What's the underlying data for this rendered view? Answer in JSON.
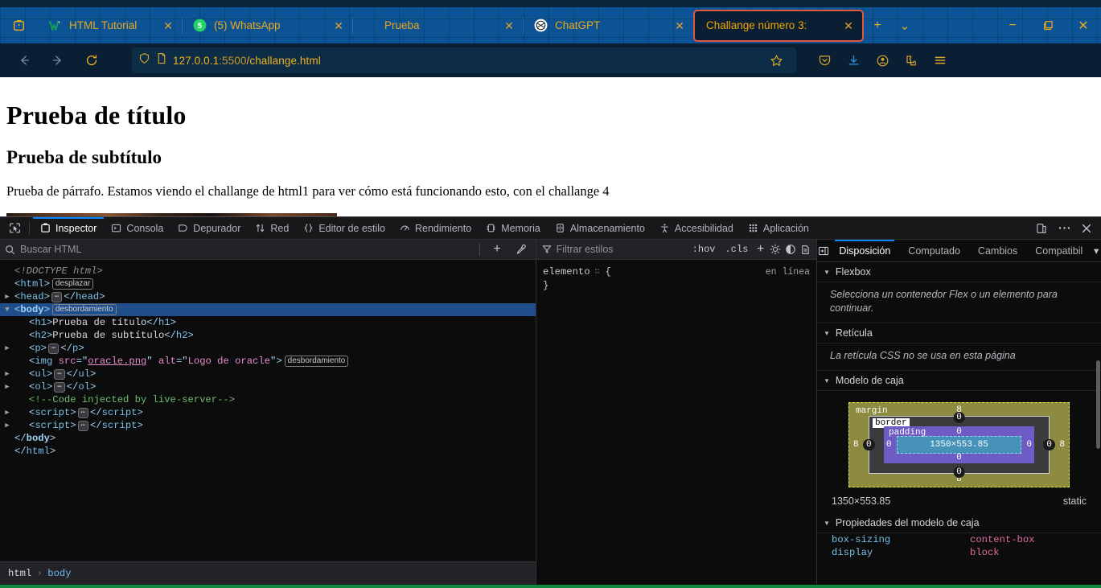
{
  "browser": {
    "tabs": [
      {
        "title": "HTML Tutorial",
        "favicon": "w3schools-icon",
        "active": false,
        "close_label": "✕"
      },
      {
        "title": "(5) WhatsApp",
        "favicon": "whatsapp-icon",
        "active": false,
        "close_label": "✕",
        "badge": "5"
      },
      {
        "title": "Prueba",
        "favicon": "blank-icon",
        "active": false,
        "close_label": "✕"
      },
      {
        "title": "ChatGPT",
        "favicon": "chatgpt-icon",
        "active": false,
        "close_label": "✕"
      },
      {
        "title": "Challange número 3:",
        "favicon": "none",
        "active": true,
        "close_label": "✕"
      }
    ],
    "new_tab_label": "+",
    "tab_list_label": "⌄",
    "window_controls": {
      "minimize": "−",
      "maximize": "❐",
      "close": "✕"
    },
    "nav": {
      "back": "←",
      "forward": "→",
      "reload": "⟳"
    },
    "url": {
      "value": "127.0.0.1:5500/challange.html",
      "host": "127.0.0.1",
      "port": ":5500",
      "path": "/challange.html"
    },
    "toolbar_icons": [
      "shield-icon",
      "page-icon",
      "bookmark-star-icon",
      "pocket-icon",
      "downloads-icon",
      "account-icon",
      "extensions-icon",
      "app-menu-icon"
    ],
    "active_tab_border_color": "#e2563c",
    "tabstrip_color": "#0b5394",
    "accent_color": "#f0a500"
  },
  "page": {
    "h1": "Prueba de título",
    "h2": "Prueba de subtítulo",
    "paragraph": "Prueba de párrafo. Estamos viendo el challange de html1 para ver cómo está funcionando esto, con el challange 4",
    "image_alt": "Logo de oracle"
  },
  "devtools": {
    "tabs": [
      {
        "label": "Inspector",
        "icon": "inspector-icon",
        "active": true
      },
      {
        "label": "Consola",
        "icon": "console-icon",
        "active": false
      },
      {
        "label": "Depurador",
        "icon": "debugger-icon",
        "active": false
      },
      {
        "label": "Red",
        "icon": "network-icon",
        "active": false
      },
      {
        "label": "Editor de estilo",
        "icon": "style-editor-icon",
        "active": false
      },
      {
        "label": "Rendimiento",
        "icon": "performance-icon",
        "active": false
      },
      {
        "label": "Memoria",
        "icon": "memory-icon",
        "active": false
      },
      {
        "label": "Almacenamiento",
        "icon": "storage-icon",
        "active": false
      },
      {
        "label": "Accesibilidad",
        "icon": "accessibility-icon",
        "active": false
      },
      {
        "label": "Aplicación",
        "icon": "application-icon",
        "active": false
      }
    ],
    "left_tools": [
      "node-picker-icon",
      "responsive-design-icon"
    ],
    "right_tools": [
      "split-console-icon",
      "meatball-menu-icon",
      "close-devtools-icon"
    ],
    "markup": {
      "search_placeholder": "Buscar HTML",
      "add_node_label": "+",
      "eyedropper_label": "eyedropper-icon",
      "tree": [
        {
          "indent": 0,
          "kind": "doctype",
          "text": "<!DOCTYPE html>"
        },
        {
          "indent": 0,
          "kind": "open",
          "tag": "html",
          "badge": "desplazar"
        },
        {
          "indent": 1,
          "kind": "collapsed",
          "tag": "head"
        },
        {
          "indent": 1,
          "kind": "open",
          "tag": "body",
          "badge": "desbordamiento",
          "selected": true
        },
        {
          "indent": 2,
          "kind": "text-node",
          "tag": "h1",
          "text": "Prueba de título"
        },
        {
          "indent": 2,
          "kind": "text-node",
          "tag": "h2",
          "text": "Prueba de subtítulo"
        },
        {
          "indent": 2,
          "kind": "collapsed",
          "tag": "p"
        },
        {
          "indent": 2,
          "kind": "img",
          "tag": "img",
          "attr_src": "src",
          "val_src": "oracle.png",
          "attr_alt": "alt",
          "val_alt": "Logo de oracle",
          "badge": "desbordamiento"
        },
        {
          "indent": 2,
          "kind": "collapsed",
          "tag": "ul"
        },
        {
          "indent": 2,
          "kind": "collapsed",
          "tag": "ol"
        },
        {
          "indent": 2,
          "kind": "comment",
          "text": "<!--Code injected by live-server-->"
        },
        {
          "indent": 2,
          "kind": "collapsed",
          "tag": "script"
        },
        {
          "indent": 2,
          "kind": "collapsed",
          "tag": "script"
        },
        {
          "indent": 1,
          "kind": "close",
          "tag": "body"
        },
        {
          "indent": 0,
          "kind": "close",
          "tag": "html"
        }
      ],
      "breadcrumb": [
        {
          "label": "html",
          "active": false
        },
        {
          "label": "body",
          "active": true
        }
      ],
      "breadcrumb_sep": "›"
    },
    "rules": {
      "filter_placeholder": "Filtrar estilos",
      "hov_label": ":hov",
      "cls_label": ".cls",
      "add_rule_label": "+",
      "toolbar_icons": [
        "light-scheme-icon",
        "dark-scheme-icon",
        "print-media-icon"
      ],
      "selector": "elemento",
      "grip": "∷",
      "open_brace": "{",
      "close_brace": "}",
      "source": "en línea"
    },
    "layout": {
      "tabs": [
        {
          "label": "Disposición",
          "active": true
        },
        {
          "label": "Computado",
          "active": false
        },
        {
          "label": "Cambios",
          "active": false
        },
        {
          "label": "Compatibil",
          "active": false
        }
      ],
      "overflow_label": "▾",
      "expand_icon": "expand-pane-icon",
      "sections": [
        {
          "title": "Flexbox",
          "note": "Selecciona un contenedor Flex o un elemento para continuar."
        },
        {
          "title": "Retícula",
          "note": "La retícula CSS no se usa en esta página"
        },
        {
          "title": "Modelo de caja",
          "note": null
        }
      ],
      "box_model": {
        "margin_label": "margin",
        "border_label": "border",
        "padding_label": "padding",
        "content_size": "1350×553.85",
        "margin": {
          "top": "8",
          "right": "8",
          "bottom": "8",
          "left": "8"
        },
        "border": {
          "top": "0",
          "right": "0",
          "bottom": "0",
          "left": "0"
        },
        "padding": {
          "top": "0",
          "right": "0",
          "bottom": "0",
          "left": "0"
        },
        "summary_size": "1350×553.85",
        "position": "static",
        "colors": {
          "margin": "#8d8b3f",
          "border": "#3b3b3e",
          "padding": "#6f5bc4",
          "content": "#4591b8"
        }
      },
      "box_props_title": "Propiedades del modelo de caja",
      "box_props": [
        {
          "name": "box-sizing",
          "value": "content-box"
        },
        {
          "name": "display",
          "value": "block"
        }
      ]
    }
  }
}
